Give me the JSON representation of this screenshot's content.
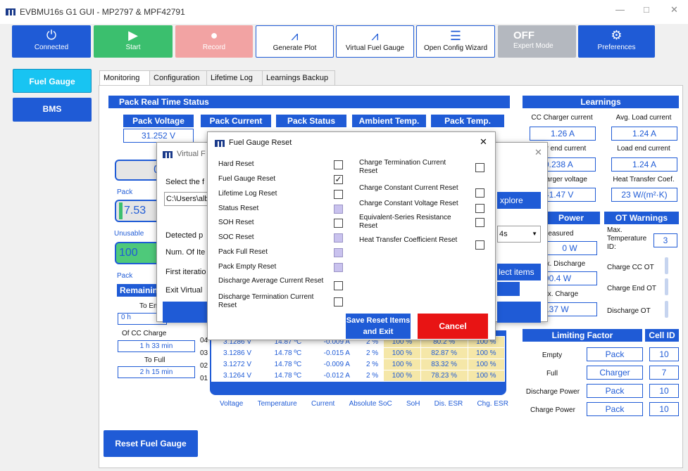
{
  "app_title": "EVBMU16s G1 GUI - MP2797 & MPF42791",
  "toolbar": [
    {
      "label": "Connected",
      "icon": "power-icon",
      "style": "blue"
    },
    {
      "label": "Start",
      "icon": "play-icon",
      "style": "green"
    },
    {
      "label": "Record",
      "icon": "record-icon",
      "style": "pink"
    },
    {
      "label": "Generate Plot",
      "icon": "chart-icon",
      "style": "white"
    },
    {
      "label": "Virtual Fuel Gauge",
      "icon": "chart-icon",
      "style": "white"
    },
    {
      "label": "Open Config Wizard",
      "icon": "list-icon",
      "style": "white"
    },
    {
      "label": "Expert Mode",
      "state": "OFF",
      "style": "grey"
    },
    {
      "label": "Preferences",
      "icon": "gear-icon",
      "style": "blue"
    }
  ],
  "side_nav": [
    "Fuel Gauge",
    "BMS"
  ],
  "tabs": [
    "Monitoring",
    "Configuration",
    "Lifetime Log",
    "Learnings Backup"
  ],
  "pack_status": {
    "title": "Pack Real Time Status",
    "headers": [
      "Pack Voltage",
      "Pack Current",
      "Pack Status",
      "Ambient Temp.",
      "Pack Temp."
    ],
    "voltage": "31.252 V"
  },
  "left_partial": {
    "pack1": "Pack",
    "val1": "7.53",
    "unusable": "Unusable",
    "val2": "100",
    "pack2": "Pack",
    "remaining": "Remainin",
    "to_empty": "To Em",
    "to_empty_val": "0 h",
    "of_cc": "Of CC Charge",
    "of_cc_val": "1 h 33 min",
    "to_full": "To Full",
    "to_full_val": "2 h 15 min",
    "cell_big": "0"
  },
  "cells": {
    "rows": [
      {
        "id": "04",
        "vals": [
          "3.1286 V",
          "14.87 ºC",
          "-0.009 A",
          "2 %",
          "100 %",
          "80.2 %",
          "100 %"
        ]
      },
      {
        "id": "03",
        "vals": [
          "3.1286 V",
          "14.78 ºC",
          "-0.015 A",
          "2 %",
          "100 %",
          "82.87 %",
          "100 %"
        ]
      },
      {
        "id": "02",
        "vals": [
          "3.1272 V",
          "14.78 ºC",
          "-0.009 A",
          "2 %",
          "100 %",
          "83.32 %",
          "100 %"
        ]
      },
      {
        "id": "01",
        "vals": [
          "3.1264 V",
          "14.78 ºC",
          "-0.012 A",
          "2 %",
          "100 %",
          "78.23 %",
          "100 %"
        ]
      }
    ],
    "columns": [
      "Voltage",
      "Temperature",
      "Current",
      "Absolute SoC",
      "SoH",
      "Dis. ESR",
      "Chg. ESR"
    ]
  },
  "reset_button": "Reset Fuel Gauge",
  "learnings": {
    "title": "Learnings",
    "items": [
      {
        "label": "CC Charger current",
        "value": "1.26 A"
      },
      {
        "label": "Avg. Load current",
        "value": "1.24 A"
      },
      {
        "label": "er end current",
        "value": "0.238 A"
      },
      {
        "label": "Load end current",
        "value": "1.24 A"
      },
      {
        "label": "harger voltage",
        "value": "41.47 V"
      },
      {
        "label": "Heat Transfer Coef.",
        "value": "23 W/(m²·K)"
      }
    ]
  },
  "power": {
    "title": "Power",
    "measured": "Measured",
    "measured_val": "0 W",
    "discharge": "ax. Discharge",
    "discharge_val": "90.4 W",
    "charge": "lax. Charge",
    "charge_val": "137 W"
  },
  "ot_warnings": {
    "title": "OT Warnings",
    "max_temp": "Max. Temperature ID:",
    "max_temp_val": "3",
    "items": [
      "Charge CC OT",
      "Charge End OT",
      "Discharge OT"
    ]
  },
  "limiting": {
    "title": "Limiting Factor",
    "cell_title": "Cell ID",
    "rows": [
      {
        "label": "Empty",
        "factor": "Pack",
        "cell": "10"
      },
      {
        "label": "Full",
        "factor": "Charger",
        "cell": "7"
      },
      {
        "label": "Discharge Power",
        "factor": "Pack",
        "cell": "10"
      },
      {
        "label": "Charge Power",
        "factor": "Pack",
        "cell": "10"
      }
    ]
  },
  "vfg_dialog": {
    "title": "Virtual F",
    "select": "Select the f",
    "path": "C:\\Users\\alb",
    "detected": "Detected p",
    "num": "Num. Of Ite",
    "first": "First iteratio",
    "exit": "Exit Virtual",
    "explore": "xplore",
    "select_items": "lect items",
    "dropdown": "4s"
  },
  "reset_dialog": {
    "title": "Fuel Gauge Reset",
    "left_items": [
      {
        "label": "Hard Reset",
        "state": "off"
      },
      {
        "label": "Fuel Gauge Reset",
        "state": "checked"
      },
      {
        "label": "Lifetime Log Reset",
        "state": "off"
      },
      {
        "label": "Status Reset",
        "state": "disabled"
      },
      {
        "label": "SOH Reset",
        "state": "off"
      },
      {
        "label": "SOC Reset",
        "state": "disabled"
      },
      {
        "label": "Pack Full Reset",
        "state": "disabled"
      },
      {
        "label": "Pack Empty Reset",
        "state": "disabled"
      },
      {
        "label": "Discharge Average Current Reset",
        "state": "off"
      },
      {
        "label": "Discharge Termination Current Reset",
        "state": "off"
      }
    ],
    "right_items": [
      {
        "label": "Charge Termination Current Reset",
        "state": "off"
      },
      {
        "label": "Charge Constant Current Reset",
        "state": "off"
      },
      {
        "label": "Charge Constant Voltage Reset",
        "state": "off"
      },
      {
        "label": "Equivalent-Series Resistance Reset",
        "state": "off"
      },
      {
        "label": "Heat Transfer Coefficient Reset",
        "state": "off"
      }
    ],
    "save_label": "Save Reset Items and Exit",
    "cancel_label": "Cancel"
  }
}
